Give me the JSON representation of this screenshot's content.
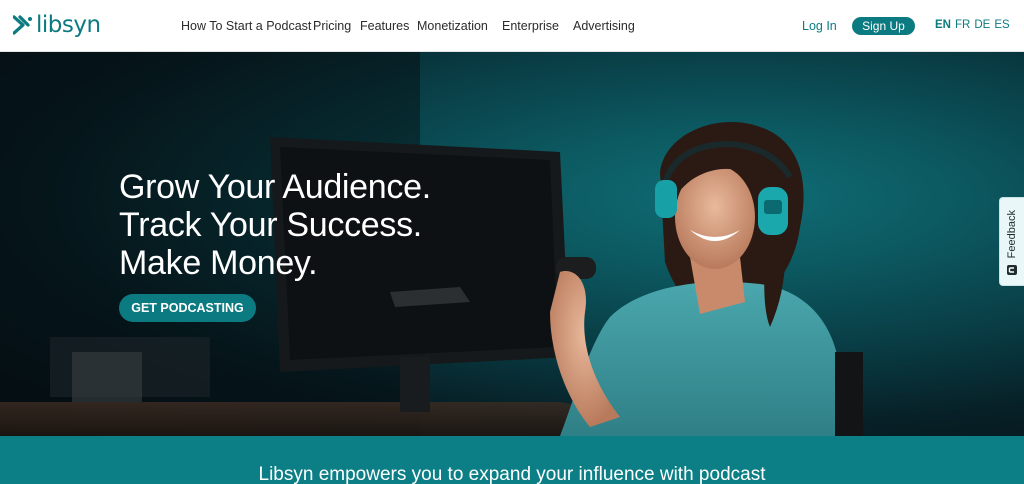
{
  "brand": {
    "name": "libsyn",
    "accent": "#0c7b81"
  },
  "nav": {
    "items": [
      {
        "label": "How To Start a Podcast"
      },
      {
        "label": "Pricing"
      },
      {
        "label": "Features"
      },
      {
        "label": "Monetization"
      },
      {
        "label": "Enterprise"
      },
      {
        "label": "Advertising"
      }
    ],
    "login": "Log In",
    "signup": "Sign Up",
    "languages": [
      "EN",
      "FR",
      "DE",
      "ES"
    ],
    "active_language": "EN"
  },
  "hero": {
    "headline": [
      "Grow Your Audience.",
      "Track Your Success.",
      "Make Money."
    ],
    "cta": "GET PODCASTING"
  },
  "feedback": {
    "label": "Feedback"
  },
  "band": {
    "text": "Libsyn empowers you to expand your influence with podcast"
  }
}
